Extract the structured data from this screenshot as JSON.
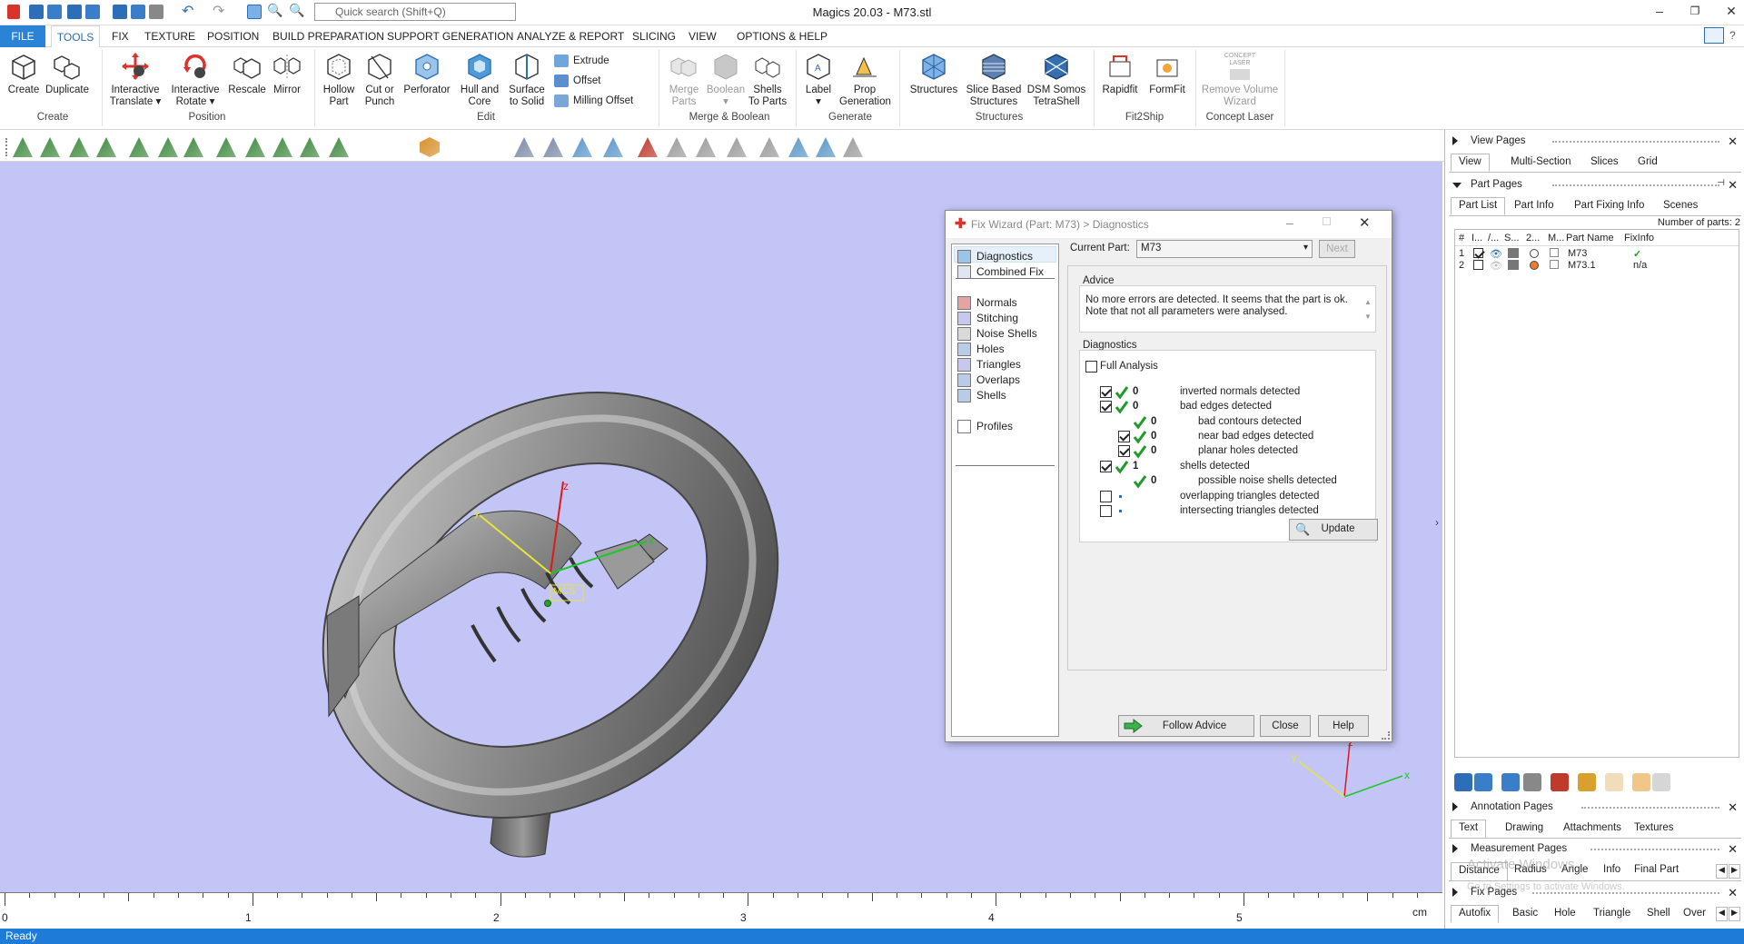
{
  "window": {
    "title": "Magics 20.03 - M73.stl",
    "search_placeholder": "Quick search (Shift+Q)"
  },
  "menu": {
    "items": [
      "FILE",
      "TOOLS",
      "FIX",
      "TEXTURE",
      "POSITION",
      "BUILD PREPARATION",
      "SUPPORT GENERATION",
      "ANALYZE & REPORT",
      "SLICING",
      "VIEW",
      "OPTIONS & HELP"
    ]
  },
  "ribbon": {
    "create": {
      "label1": "Create",
      "duplicate": "Duplicate",
      "group": "Create"
    },
    "position": {
      "translate": "Interactive",
      "translate2": "Translate",
      "rotate": "Interactive",
      "rotate2": "Rotate",
      "rescale": "Rescale",
      "mirror": "Mirror",
      "group": "Position"
    },
    "edit": {
      "hollow": "Hollow",
      "hollow2": "Part",
      "cut": "Cut or",
      "cut2": "Punch",
      "perforator": "Perforator",
      "hull": "Hull and",
      "hull2": "Core",
      "surface": "Surface",
      "surface2": "to Solid",
      "extrude": "Extrude",
      "offset": "Offset",
      "milling": "Milling Offset",
      "group": "Edit"
    },
    "merge": {
      "merge": "Merge",
      "merge2": "Parts",
      "boolean": "Boolean",
      "shells": "Shells",
      "shells2": "To Parts",
      "group": "Merge & Boolean"
    },
    "generate": {
      "label": "Label",
      "prop": "Prop",
      "prop2": "Generation",
      "group": "Generate"
    },
    "structures": {
      "structures": "Structures",
      "slice": "Slice Based",
      "slice2": "Structures",
      "dsm": "DSM Somos",
      "dsm2": "TetraShell",
      "group": "Structures"
    },
    "fit2ship": {
      "rapidfit": "Rapidfit",
      "formfit": "FormFit",
      "group": "Fit2Ship"
    },
    "concept": {
      "remove": "Remove Volume",
      "remove2": "Wizard",
      "logo1": "CONCEPT",
      "logo2": "LASER",
      "group": "Concept Laser"
    }
  },
  "viewport": {
    "background": "#c3c5f7",
    "axis_z": "z",
    "axis_x": "x",
    "axis_y": "y",
    "mcs": "MCS",
    "ruler": {
      "labels": [
        "0",
        "1",
        "2",
        "3",
        "4",
        "5"
      ],
      "unit": "cm"
    }
  },
  "status": {
    "text": "Ready"
  },
  "dialog": {
    "title": "Fix Wizard (Part: M73) > Diagnostics",
    "nav": [
      "Diagnostics",
      "Combined Fix",
      "Normals",
      "Stitching",
      "Noise Shells",
      "Holes",
      "Triangles",
      "Overlaps",
      "Shells",
      "Profiles"
    ],
    "current_part_label": "Current Part:",
    "current_part_value": "M73",
    "next": "Next",
    "advice_title": "Advice",
    "advice_text1": "No more errors are detected. It seems that the part is ok.",
    "advice_text2": "Note that not all parameters were analysed.",
    "diagnostics_title": "Diagnostics",
    "full_analysis": "Full Analysis",
    "rows": [
      {
        "count": "0",
        "label": "inverted normals detected",
        "checked": true,
        "ok": true
      },
      {
        "count": "0",
        "label": "bad edges detected",
        "checked": true,
        "ok": true
      },
      {
        "count": "0",
        "label": "bad contours detected",
        "checked": false,
        "ok": true
      },
      {
        "count": "0",
        "label": "near bad edges detected",
        "checked": true,
        "ok": true
      },
      {
        "count": "0",
        "label": "planar holes detected",
        "checked": true,
        "ok": true
      },
      {
        "count": "1",
        "label": "shells detected",
        "checked": true,
        "ok": true
      },
      {
        "count": "0",
        "label": "possible noise shells detected",
        "checked": false,
        "ok": true
      },
      {
        "count": "",
        "label": "overlapping triangles detected",
        "checked": false,
        "ok": false
      },
      {
        "count": "",
        "label": "intersecting triangles detected",
        "checked": false,
        "ok": false
      }
    ],
    "update": "Update",
    "follow_advice": "Follow Advice",
    "close": "Close",
    "help": "Help"
  },
  "panel": {
    "view_pages": "View Pages",
    "view_tabs": [
      "View",
      "Multi-Section",
      "Slices",
      "Grid"
    ],
    "part_pages": "Part Pages",
    "part_tabs": [
      "Part List",
      "Part Info",
      "Part Fixing Info",
      "Scenes"
    ],
    "num_parts": "Number of parts: 2",
    "columns": [
      "#",
      "I...",
      "/...",
      "S...",
      "2...",
      "M...",
      "Part Name",
      "FixInfo"
    ],
    "parts": [
      {
        "num": "1",
        "name": "M73",
        "fix": "✓",
        "color": "#f7f7f7"
      },
      {
        "num": "2",
        "name": "M73.1",
        "fix": "n/a",
        "color": "#ee7b30"
      }
    ],
    "annotation_pages": "Annotation Pages",
    "annotation_tabs": [
      "Text",
      "Drawing",
      "Attachments",
      "Textures"
    ],
    "measurement_pages": "Measurement Pages",
    "measurement_tabs": [
      "Distance",
      "Radius",
      "Angle",
      "Info",
      "Final Part"
    ],
    "fix_pages": "Fix Pages",
    "fix_tabs": [
      "Autofix",
      "Basic",
      "Hole",
      "Triangle",
      "Shell",
      "Over"
    ],
    "watermark1": "Activate Windows",
    "watermark2": "Go to Settings to activate Windows."
  }
}
